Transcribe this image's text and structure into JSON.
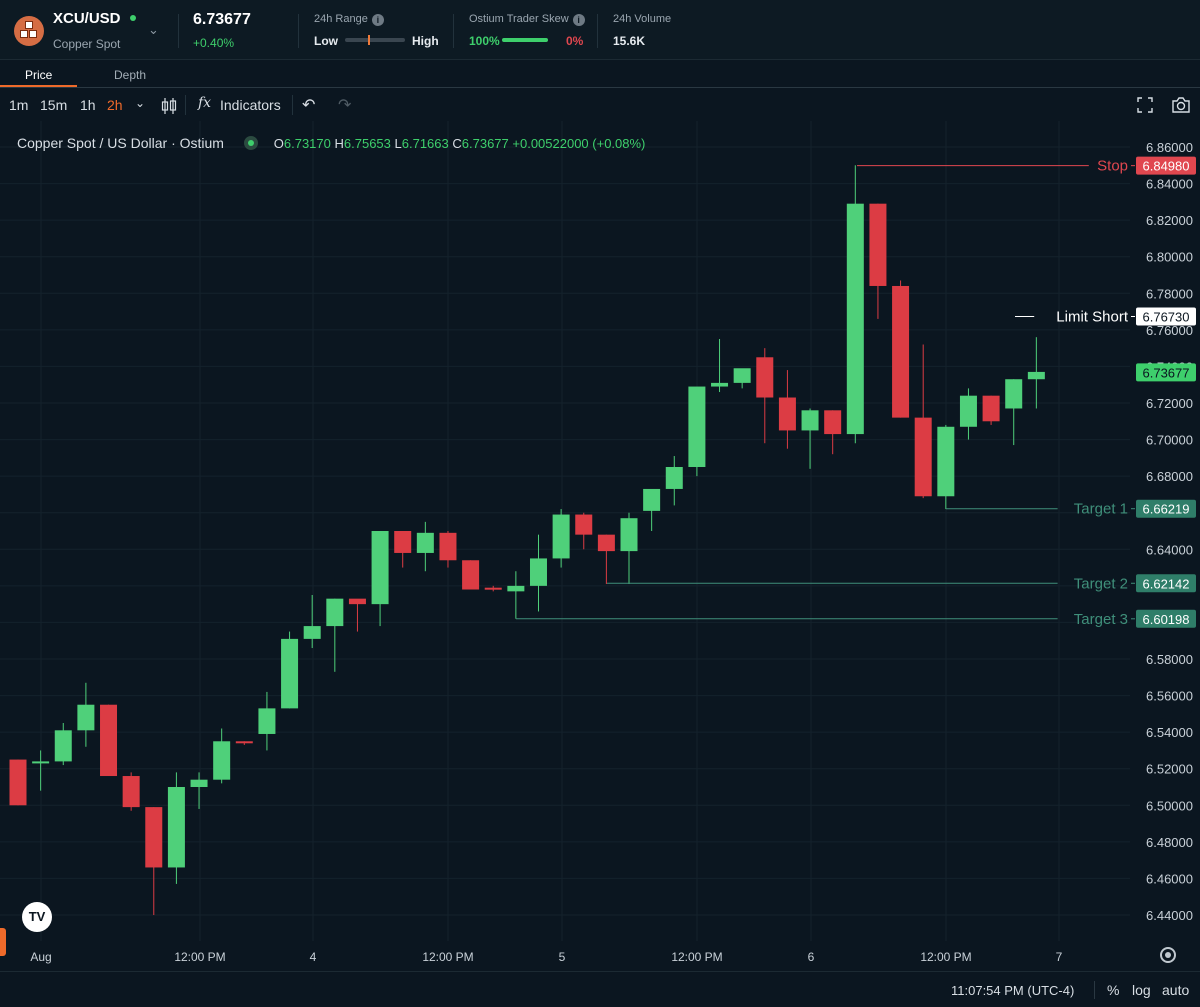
{
  "header": {
    "symbol": "XCU/USD",
    "subtitle": "Copper Spot",
    "price": "6.73677",
    "change": "+0.40%",
    "range_label": "24h Range",
    "range_low": "Low",
    "range_high": "High",
    "skew_label": "Ostium Trader Skew",
    "skew_long": "100%",
    "skew_short": "0%",
    "volume_label": "24h Volume",
    "volume_value": "15.6K"
  },
  "tabs": [
    "Price",
    "Depth"
  ],
  "toolbar": {
    "timeframes": [
      "1m",
      "15m",
      "1h",
      "2h"
    ],
    "active_timeframe": "2h",
    "indicators_label": "Indicators",
    "fx_glyph": "fx"
  },
  "legend": {
    "title": "Copper Spot / US Dollar · Ostium",
    "o": "6.73170",
    "h": "6.75653",
    "l": "6.71663",
    "c": "6.73677",
    "chg": "+0.00522000 (+0.08%)"
  },
  "tv_logo": "TV",
  "footer": {
    "time": "11:07:54 PM (UTC-4)",
    "percent": "%",
    "log": "log",
    "auto": "auto"
  },
  "colors": {
    "up": "#4fd07a",
    "down": "#dc3c44",
    "accent": "#ef6a2a",
    "background": "#0b1620"
  },
  "chart_data": {
    "type": "candlestick",
    "y_ticks": [
      "6.86000",
      "6.84000",
      "6.82000",
      "6.80000",
      "6.78000",
      "6.76000",
      "6.74000",
      "6.72000",
      "6.70000",
      "6.68000",
      "6.66000",
      "6.64000",
      "6.62000",
      "6.60000",
      "6.58000",
      "6.56000",
      "6.54000",
      "6.52000",
      "6.50000",
      "6.48000",
      "6.46000",
      "6.44000"
    ],
    "y_range": [
      6.43,
      6.87
    ],
    "x_ticks": [
      "Aug",
      "12:00 PM",
      "4",
      "12:00 PM",
      "5",
      "12:00 PM",
      "6",
      "12:00 PM",
      "7"
    ],
    "candles": [
      {
        "o": 6.525,
        "h": 6.525,
        "l": 6.5,
        "c": 6.5
      },
      {
        "o": 6.523,
        "h": 6.53,
        "l": 6.508,
        "c": 6.524
      },
      {
        "o": 6.524,
        "h": 6.545,
        "l": 6.522,
        "c": 6.541
      },
      {
        "o": 6.541,
        "h": 6.567,
        "l": 6.532,
        "c": 6.555
      },
      {
        "o": 6.555,
        "h": 6.555,
        "l": 6.517,
        "c": 6.516
      },
      {
        "o": 6.516,
        "h": 6.518,
        "l": 6.497,
        "c": 6.499
      },
      {
        "o": 6.499,
        "h": 6.499,
        "l": 6.44,
        "c": 6.466
      },
      {
        "o": 6.466,
        "h": 6.518,
        "l": 6.457,
        "c": 6.51
      },
      {
        "o": 6.51,
        "h": 6.518,
        "l": 6.498,
        "c": 6.514
      },
      {
        "o": 6.514,
        "h": 6.542,
        "l": 6.512,
        "c": 6.535
      },
      {
        "o": 6.535,
        "h": 6.535,
        "l": 6.533,
        "c": 6.534
      },
      {
        "o": 6.539,
        "h": 6.562,
        "l": 6.53,
        "c": 6.553
      },
      {
        "o": 6.553,
        "h": 6.595,
        "l": 6.553,
        "c": 6.591
      },
      {
        "o": 6.591,
        "h": 6.615,
        "l": 6.586,
        "c": 6.598
      },
      {
        "o": 6.598,
        "h": 6.613,
        "l": 6.573,
        "c": 6.613
      },
      {
        "o": 6.613,
        "h": 6.612,
        "l": 6.595,
        "c": 6.61
      },
      {
        "o": 6.61,
        "h": 6.625,
        "l": 6.598,
        "c": 6.65
      },
      {
        "o": 6.65,
        "h": 6.65,
        "l": 6.63,
        "c": 6.638
      },
      {
        "o": 6.638,
        "h": 6.655,
        "l": 6.628,
        "c": 6.649
      },
      {
        "o": 6.649,
        "h": 6.65,
        "l": 6.63,
        "c": 6.634
      },
      {
        "o": 6.634,
        "h": 6.634,
        "l": 6.618,
        "c": 6.618
      },
      {
        "o": 6.619,
        "h": 6.62,
        "l": 6.617,
        "c": 6.618
      },
      {
        "o": 6.617,
        "h": 6.628,
        "l": 6.602,
        "c": 6.62
      },
      {
        "o": 6.62,
        "h": 6.648,
        "l": 6.606,
        "c": 6.635
      },
      {
        "o": 6.635,
        "h": 6.662,
        "l": 6.63,
        "c": 6.659
      },
      {
        "o": 6.659,
        "h": 6.66,
        "l": 6.64,
        "c": 6.648
      },
      {
        "o": 6.648,
        "h": 6.648,
        "l": 6.621,
        "c": 6.639
      },
      {
        "o": 6.639,
        "h": 6.66,
        "l": 6.621,
        "c": 6.657
      },
      {
        "o": 6.661,
        "h": 6.669,
        "l": 6.65,
        "c": 6.673
      },
      {
        "o": 6.673,
        "h": 6.691,
        "l": 6.664,
        "c": 6.685
      },
      {
        "o": 6.685,
        "h": 6.728,
        "l": 6.68,
        "c": 6.729
      },
      {
        "o": 6.729,
        "h": 6.755,
        "l": 6.726,
        "c": 6.731
      },
      {
        "o": 6.731,
        "h": 6.733,
        "l": 6.728,
        "c": 6.739
      },
      {
        "o": 6.745,
        "h": 6.75,
        "l": 6.698,
        "c": 6.723
      },
      {
        "o": 6.723,
        "h": 6.738,
        "l": 6.695,
        "c": 6.705
      },
      {
        "o": 6.705,
        "h": 6.717,
        "l": 6.684,
        "c": 6.716
      },
      {
        "o": 6.716,
        "h": 6.716,
        "l": 6.692,
        "c": 6.703
      },
      {
        "o": 6.703,
        "h": 6.85,
        "l": 6.698,
        "c": 6.829
      },
      {
        "o": 6.829,
        "h": 6.829,
        "l": 6.766,
        "c": 6.784
      },
      {
        "o": 6.784,
        "h": 6.787,
        "l": 6.712,
        "c": 6.712
      },
      {
        "o": 6.712,
        "h": 6.752,
        "l": 6.668,
        "c": 6.669
      },
      {
        "o": 6.669,
        "h": 6.708,
        "l": 6.662,
        "c": 6.707
      },
      {
        "o": 6.707,
        "h": 6.728,
        "l": 6.7,
        "c": 6.724
      },
      {
        "o": 6.724,
        "h": 6.724,
        "l": 6.708,
        "c": 6.71
      },
      {
        "o": 6.717,
        "h": 6.733,
        "l": 6.697,
        "c": 6.733
      },
      {
        "o": 6.733,
        "h": 6.756,
        "l": 6.717,
        "c": 6.737
      }
    ],
    "price_lines": [
      {
        "label": "Stop",
        "value": "6.84980",
        "kind": "stop"
      },
      {
        "label": "Limit Short",
        "value": "6.76730",
        "kind": "limit"
      },
      {
        "label": "Target 1",
        "value": "6.66219",
        "kind": "target"
      },
      {
        "label": "Target 2",
        "value": "6.62142",
        "kind": "target"
      },
      {
        "label": "Target 3",
        "value": "6.60198",
        "kind": "target"
      }
    ],
    "last_price": "6.73677"
  }
}
